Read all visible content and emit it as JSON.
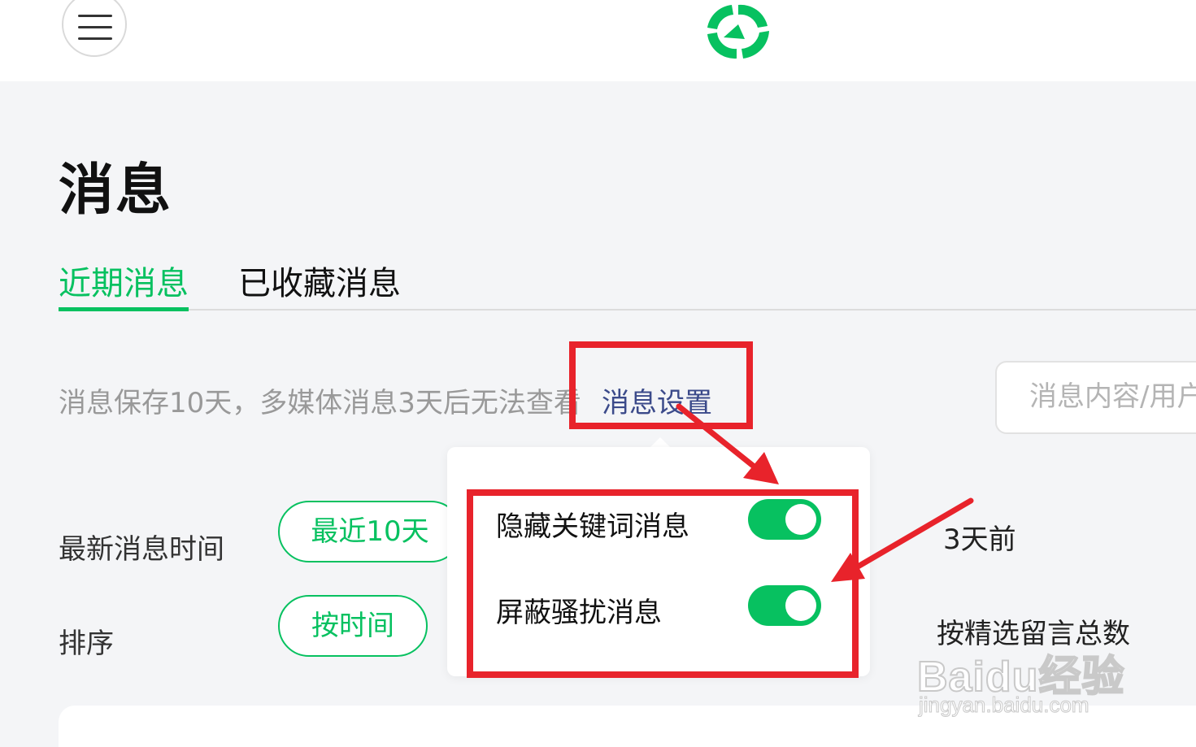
{
  "header": {
    "menu_icon": "hamburger-menu-icon",
    "logo_icon": "wechat-reading-logo-icon",
    "brand_color": "#07c160"
  },
  "page": {
    "title": "消息"
  },
  "tabs": [
    {
      "label": "近期消息",
      "active": true
    },
    {
      "label": "已收藏消息",
      "active": false
    }
  ],
  "notice": {
    "text": "消息保存10天，多媒体消息3天后无法查看",
    "settings_link": "消息设置"
  },
  "search": {
    "placeholder": "消息内容/用户"
  },
  "filters": {
    "time": {
      "label": "最新消息时间",
      "selected": "最近10天",
      "other_option": "3天前"
    },
    "sort": {
      "label": "排序",
      "selected": "按时间",
      "other_option": "按精选留言总数"
    }
  },
  "popover": {
    "items": [
      {
        "label": "隐藏关键词消息",
        "enabled": true
      },
      {
        "label": "屏蔽骚扰消息",
        "enabled": true
      }
    ]
  },
  "annotation": {
    "color": "#e8232b"
  },
  "watermark": {
    "main": "Baidu经验",
    "sub": "jingyan.baidu.com"
  }
}
